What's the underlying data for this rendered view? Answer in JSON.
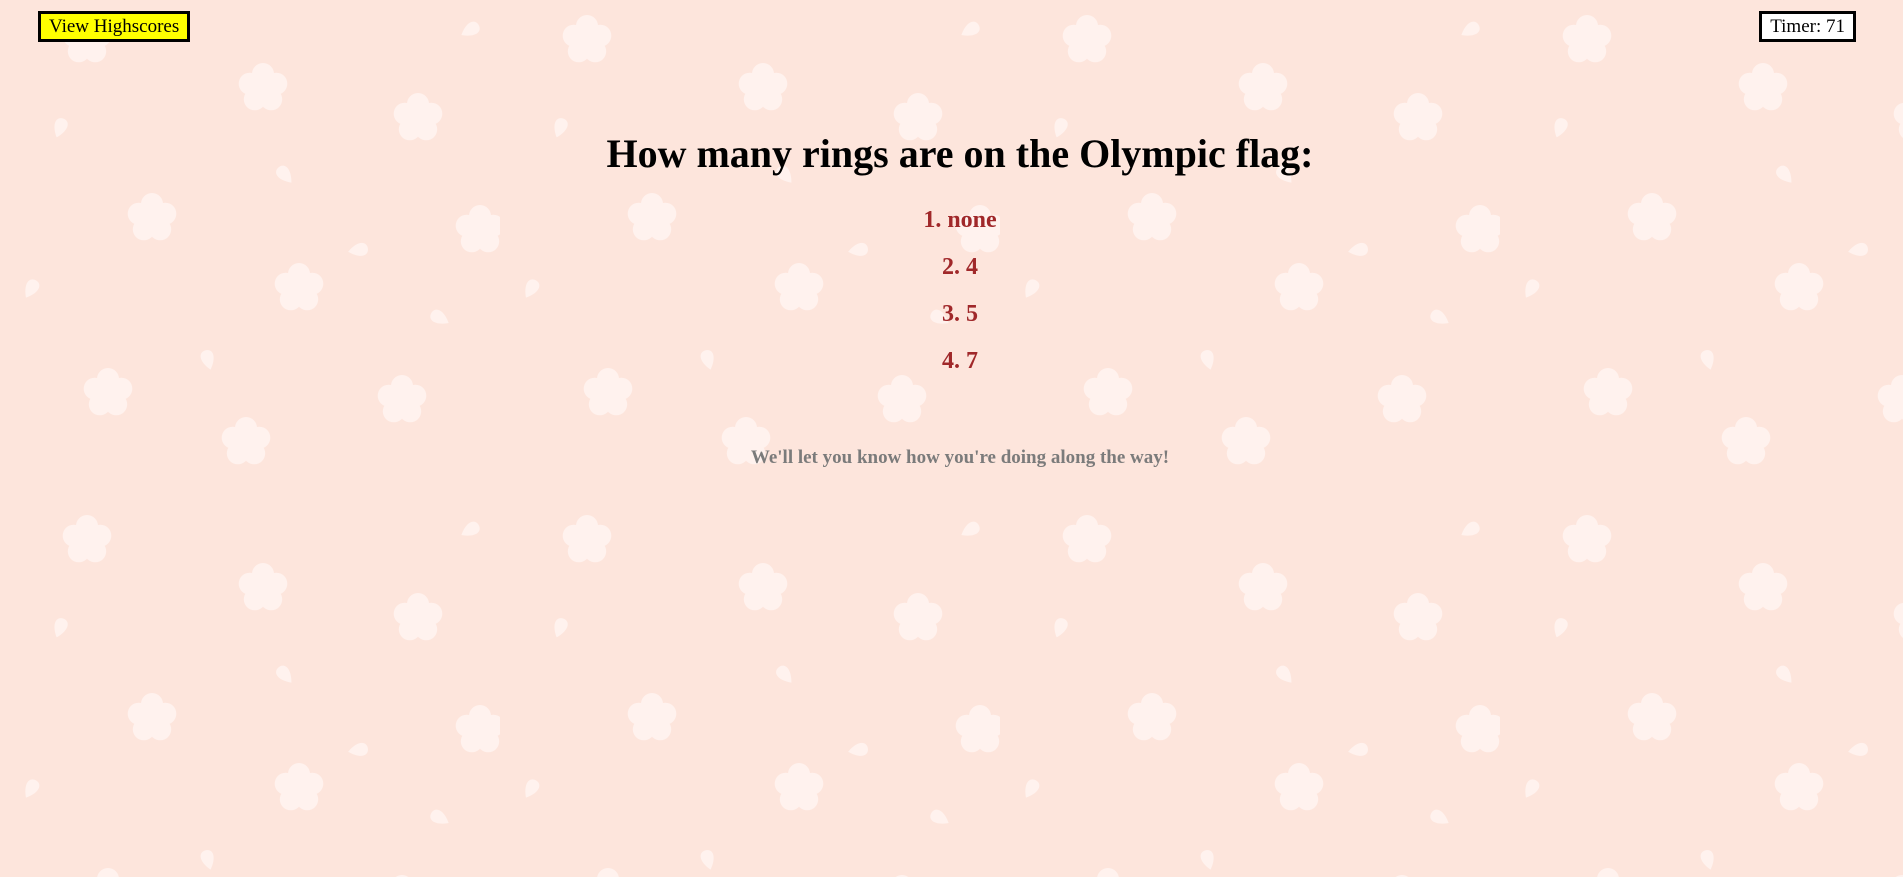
{
  "header": {
    "highscores_label": "View Highscores",
    "timer_label": "Timer:",
    "timer_value": "71"
  },
  "quiz": {
    "question": "How many rings are on the Olympic flag:",
    "choices": [
      {
        "label": "1. none"
      },
      {
        "label": "2. 4"
      },
      {
        "label": "3. 5"
      },
      {
        "label": "4. 7"
      }
    ],
    "feedback": "We'll let you know how you're doing along the way!"
  },
  "colors": {
    "background": "#fde5dc",
    "pattern": "#fff2ee",
    "highscores_button": "#ffff00",
    "choice_text": "#a0282a",
    "feedback_text": "#7b7b7b"
  },
  "icons": {
    "background_pattern": "flower-icon"
  }
}
